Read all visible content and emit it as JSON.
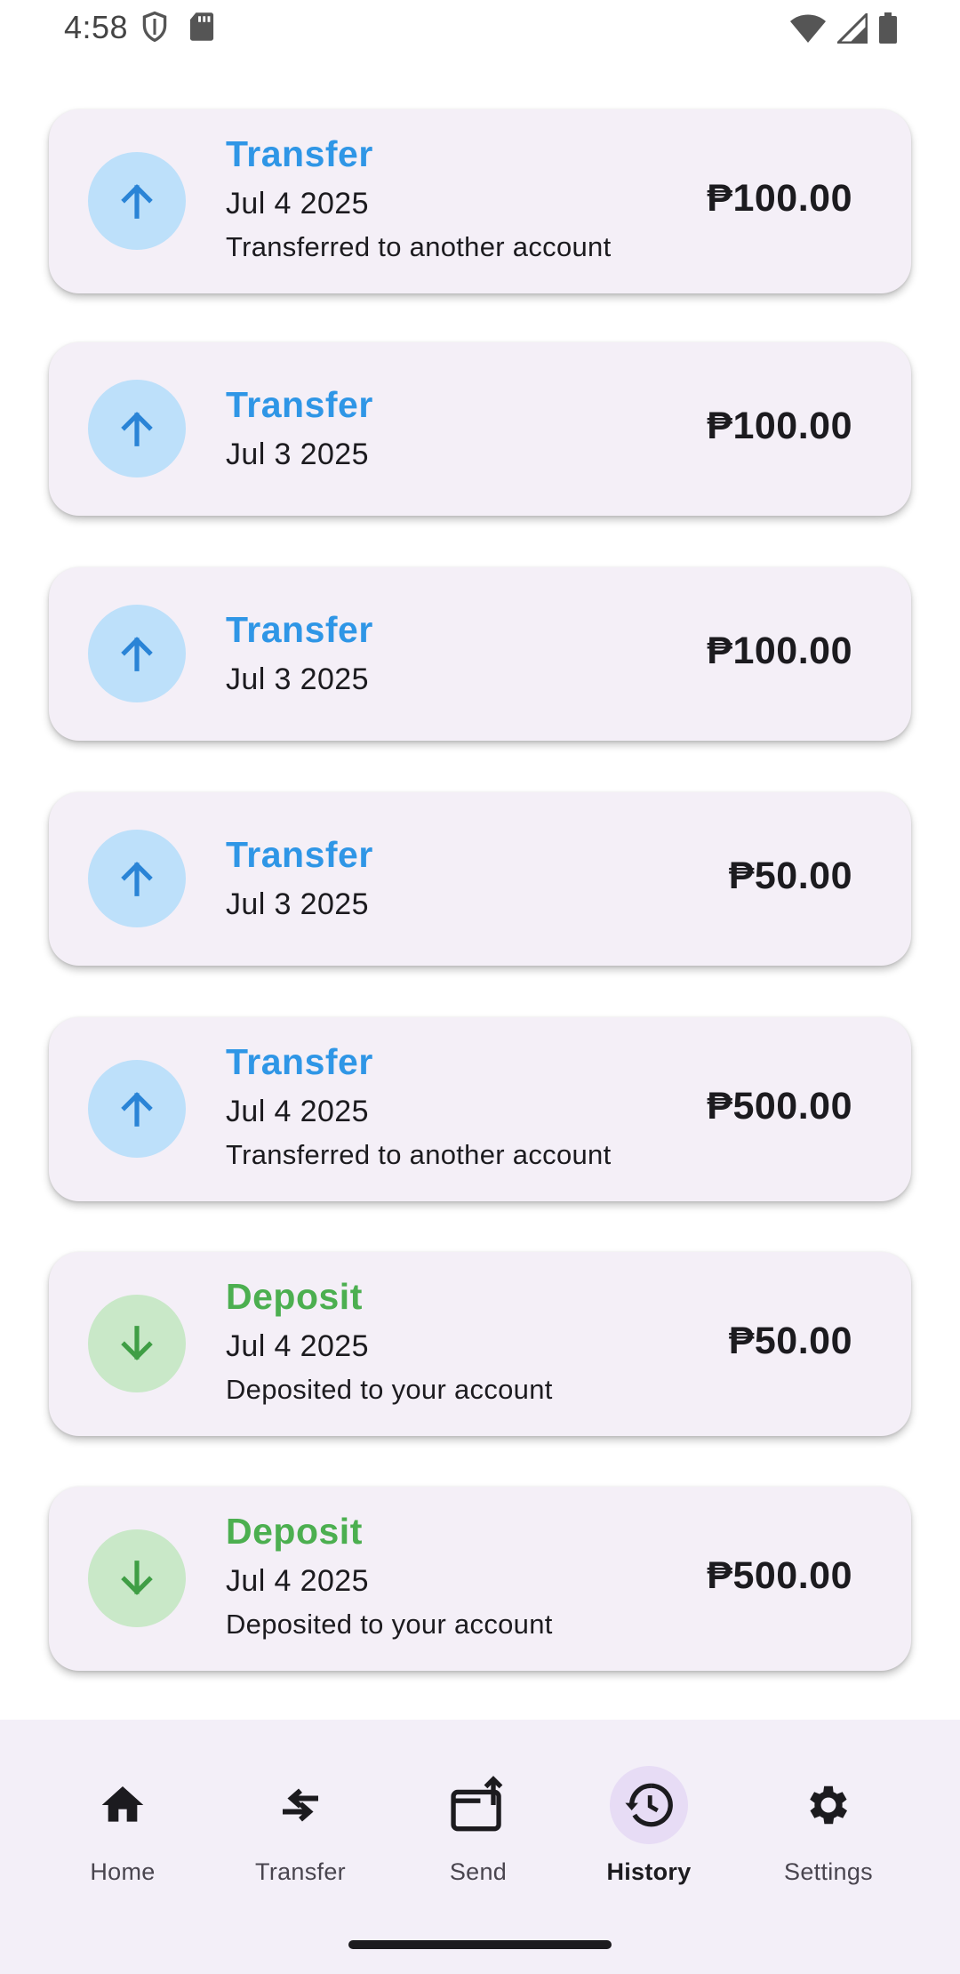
{
  "status_bar": {
    "time": "4:58",
    "left_icons": [
      "shield-icon",
      "sd-card-icon"
    ],
    "right_icons": [
      "wifi-icon",
      "signal-icon",
      "battery-icon"
    ]
  },
  "transactions": [
    {
      "type": "Transfer",
      "kind": "transfer",
      "date": "Jul 4 2025",
      "description": "Transferred to another account",
      "amount": "₱100.00",
      "icon": "arrow-up-icon"
    },
    {
      "type": "Transfer",
      "kind": "transfer",
      "date": "Jul 3 2025",
      "description": "",
      "amount": "₱100.00",
      "icon": "arrow-up-icon"
    },
    {
      "type": "Transfer",
      "kind": "transfer",
      "date": "Jul 3 2025",
      "description": "",
      "amount": "₱100.00",
      "icon": "arrow-up-icon"
    },
    {
      "type": "Transfer",
      "kind": "transfer",
      "date": "Jul 3 2025",
      "description": "",
      "amount": "₱50.00",
      "icon": "arrow-up-icon"
    },
    {
      "type": "Transfer",
      "kind": "transfer",
      "date": "Jul 4 2025",
      "description": "Transferred to another account",
      "amount": "₱500.00",
      "icon": "arrow-up-icon"
    },
    {
      "type": "Deposit",
      "kind": "deposit",
      "date": "Jul 4 2025",
      "description": "Deposited to your account",
      "amount": "₱50.00",
      "icon": "arrow-down-icon"
    },
    {
      "type": "Deposit",
      "kind": "deposit",
      "date": "Jul 4 2025",
      "description": "Deposited to your account",
      "amount": "₱500.00",
      "icon": "arrow-down-icon"
    }
  ],
  "nav": {
    "items": [
      {
        "label": "Home",
        "icon": "home-icon",
        "active": false
      },
      {
        "label": "Transfer",
        "icon": "transfer-arrows-icon",
        "active": false
      },
      {
        "label": "Send",
        "icon": "send-wallet-icon",
        "active": false
      },
      {
        "label": "History",
        "icon": "history-icon",
        "active": true
      },
      {
        "label": "Settings",
        "icon": "gear-icon",
        "active": false
      }
    ]
  },
  "colors": {
    "transfer_accent": "#2f96e6",
    "transfer_bg": "#bde0fa",
    "deposit_accent": "#4caf50",
    "deposit_bg": "#c9e8c8",
    "card_bg": "#f4eff7",
    "nav_bg": "#f3eff8",
    "nav_active_bg": "#e7dcf5"
  }
}
